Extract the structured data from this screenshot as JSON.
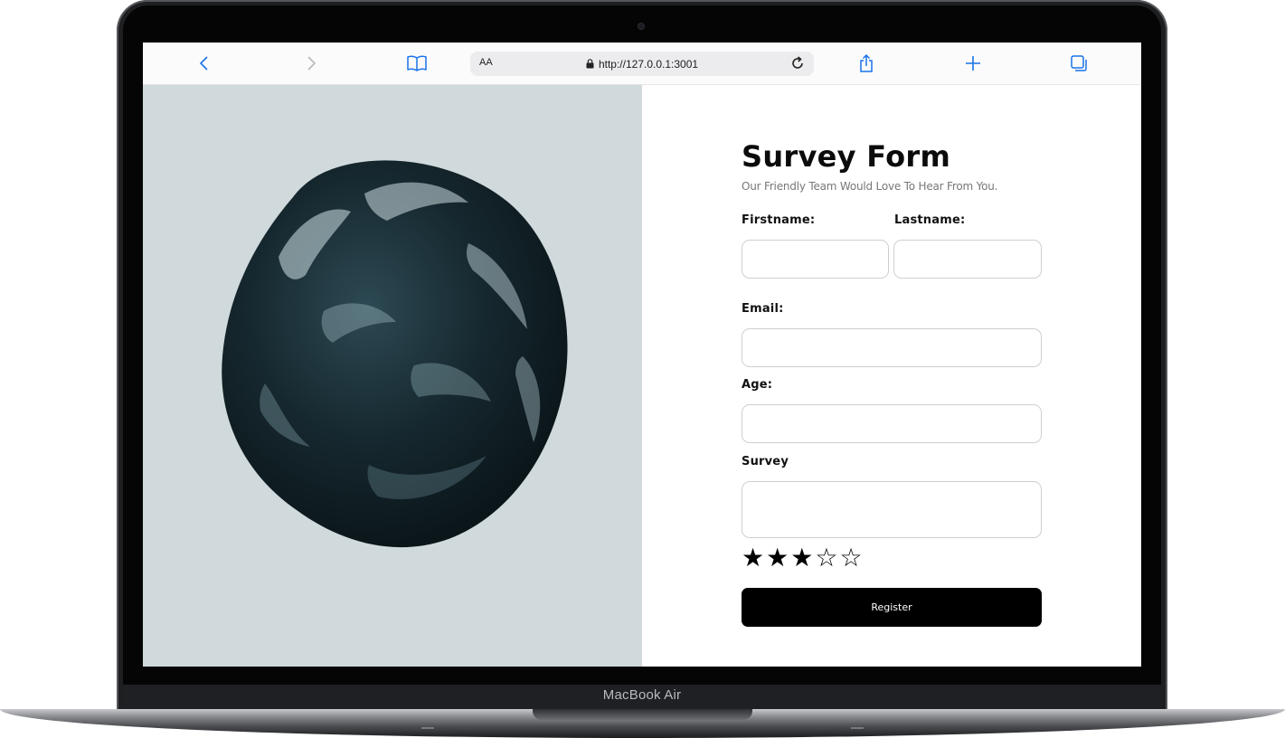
{
  "browser": {
    "url": "http://127.0.0.1:3001",
    "reader_label": "AA"
  },
  "device": {
    "label": "MacBook Air"
  },
  "form": {
    "title": "Survey Form",
    "subtitle": "Our Friendly Team Would Love To Hear From You.",
    "firstname_label": "Firstname:",
    "lastname_label": "Lastname:",
    "email_label": "Email:",
    "age_label": "Age:",
    "survey_label": "Survey",
    "firstname_value": "",
    "lastname_value": "",
    "email_value": "",
    "age_value": "",
    "survey_value": "",
    "rating": 3,
    "rating_max": 5,
    "register_label": "Register"
  },
  "colors": {
    "hero_background": "#d0d9db",
    "blob": "#14262d",
    "button": "#000000",
    "browser_accent": "#1a73e8"
  },
  "icons": [
    "back-icon",
    "forward-icon",
    "bookmarks-icon",
    "lock-icon",
    "reload-icon",
    "share-icon",
    "new-tab-icon",
    "tabs-icon",
    "star-icon"
  ]
}
